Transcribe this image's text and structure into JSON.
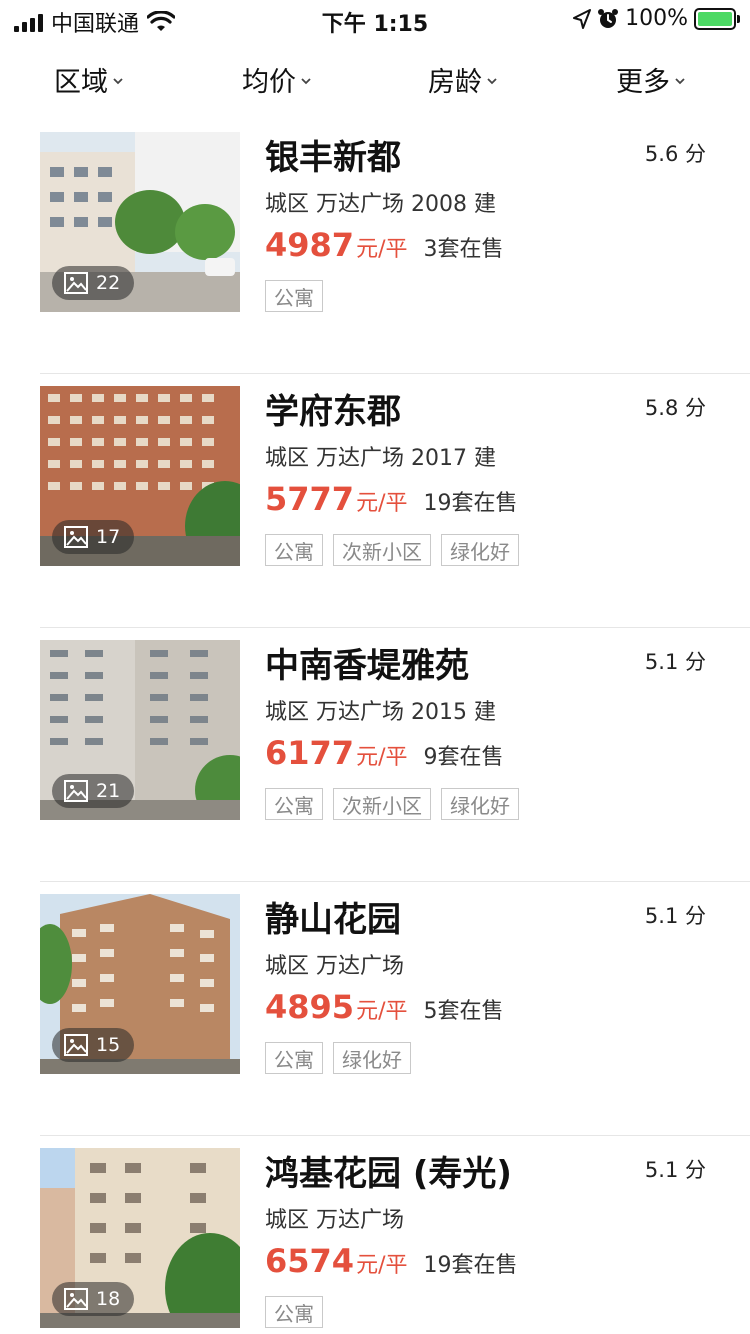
{
  "status_bar": {
    "carrier": "中国联通",
    "time": "下午 1:15",
    "battery": "100%"
  },
  "filters": [
    {
      "label": "区域"
    },
    {
      "label": "均价"
    },
    {
      "label": "房龄"
    },
    {
      "label": "更多"
    }
  ],
  "listings": [
    {
      "name": "银丰新都",
      "score": "5.6 分",
      "meta": "城区 万达广场 2008 建",
      "price": "4987",
      "unit": "元/平",
      "on_sale": "3套在售",
      "photos": "22",
      "tags": [
        "公寓"
      ]
    },
    {
      "name": "学府东郡",
      "score": "5.8 分",
      "meta": "城区 万达广场 2017 建",
      "price": "5777",
      "unit": "元/平",
      "on_sale": "19套在售",
      "photos": "17",
      "tags": [
        "公寓",
        "次新小区",
        "绿化好"
      ]
    },
    {
      "name": "中南香堤雅苑",
      "score": "5.1 分",
      "meta": "城区 万达广场 2015 建",
      "price": "6177",
      "unit": "元/平",
      "on_sale": "9套在售",
      "photos": "21",
      "tags": [
        "公寓",
        "次新小区",
        "绿化好"
      ]
    },
    {
      "name": "静山花园",
      "score": "5.1 分",
      "meta": "城区 万达广场",
      "price": "4895",
      "unit": "元/平",
      "on_sale": "5套在售",
      "photos": "15",
      "tags": [
        "公寓",
        "绿化好"
      ]
    },
    {
      "name": "鸿基花园 (寿光)",
      "score": "5.1 分",
      "meta": "城区 万达广场",
      "price": "6574",
      "unit": "元/平",
      "on_sale": "19套在售",
      "photos": "18",
      "tags": [
        "公寓"
      ]
    }
  ]
}
